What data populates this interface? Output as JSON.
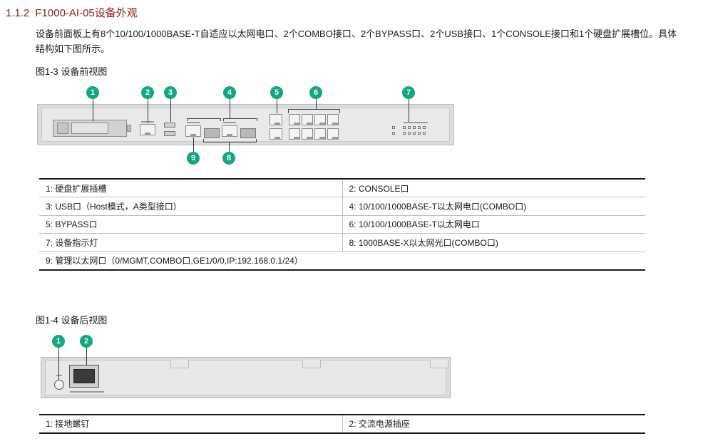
{
  "section": {
    "number": "1.1.2",
    "title": "F1000-AI-05设备外观"
  },
  "intro": "设备前面板上有8个10/100/1000BASE-T自适应以太网电口、2个COMBO接口、2个BYPASS口、2个USB接口、1个CONSOLE接口和1个硬盘扩展槽位。具体结构如下图所示。",
  "front_figure": {
    "title": "图1-3 设备前视图",
    "callouts": [
      "1",
      "2",
      "3",
      "4",
      "5",
      "6",
      "7",
      "9",
      "8"
    ],
    "legend": [
      [
        "1: 硬盘扩展插槽",
        "2: CONSOLE口"
      ],
      [
        "3: USB口（Host模式，A类型接口）",
        "4: 10/100/1000BASE-T以太网电口(COMBO口)"
      ],
      [
        "5: BYPASS口",
        "6: 10/100/1000BASE-T以太网电口"
      ],
      [
        "7: 设备指示灯",
        "8: 1000BASE-X以太网光口(COMBO口)"
      ],
      [
        "9: 管理以太网口（0/MGMT,COMBO口,GE1/0/0,IP:192.168.0.1/24）"
      ]
    ]
  },
  "rear_figure": {
    "title": "图1-4 设备后视图",
    "callouts": [
      "1",
      "2"
    ],
    "legend": [
      [
        "1: 接地螺钉",
        "2: 交流电源插座"
      ]
    ]
  },
  "colors": {
    "heading": "#8a1c1c",
    "callout": "#13a683"
  }
}
